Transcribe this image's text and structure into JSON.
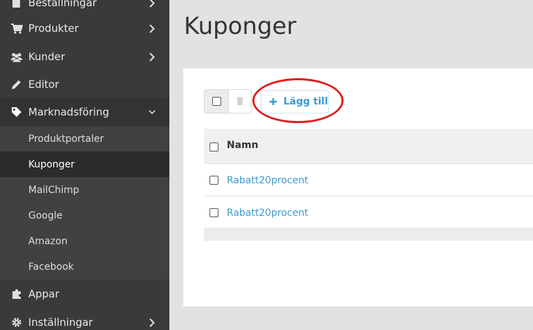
{
  "sidebar": {
    "items": [
      {
        "label": "Beställningar",
        "icon": "orders-icon"
      },
      {
        "label": "Produkter",
        "icon": "cart-icon"
      },
      {
        "label": "Kunder",
        "icon": "users-icon"
      },
      {
        "label": "Editor",
        "icon": "pencil-icon"
      },
      {
        "label": "Marknadsföring",
        "icon": "tag-icon"
      },
      {
        "label": "Appar",
        "icon": "puzzle-icon"
      },
      {
        "label": "Inställningar",
        "icon": "gear-icon"
      }
    ],
    "submenu": [
      {
        "label": "Produktportaler"
      },
      {
        "label": "Kuponger"
      },
      {
        "label": "MailChimp"
      },
      {
        "label": "Google"
      },
      {
        "label": "Amazon"
      },
      {
        "label": "Facebook"
      }
    ]
  },
  "page": {
    "title": "Kuponger"
  },
  "toolbar": {
    "add_label": "Lägg till"
  },
  "table": {
    "columns": [
      "Namn"
    ],
    "rows": [
      {
        "name": "Rabatt20procent"
      },
      {
        "name": "Rabatt20procent"
      }
    ]
  },
  "colors": {
    "sidebar_bg": "#3a3a3a",
    "accent": "#3b9ad0",
    "highlight": "#e21e1e"
  }
}
